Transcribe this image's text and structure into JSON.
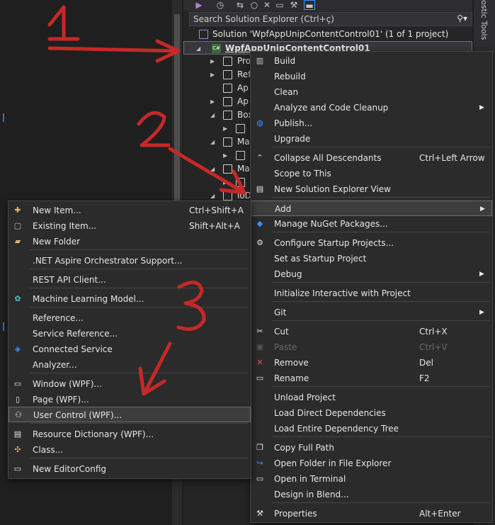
{
  "solution_explorer": {
    "search_placeholder": "Search Solution Explorer (Ctrl+ç)",
    "solution_label": "Solution 'WpfAppUnipContentControl01' (1 of 1 project)",
    "project_label": "WpfAppUnipContentControl01",
    "tree": [
      {
        "label": "Pro"
      },
      {
        "label": "Ref"
      },
      {
        "label": "Ap"
      },
      {
        "label": "Ap"
      },
      {
        "label": "Box"
      },
      {
        "label": ""
      },
      {
        "label": "Ma"
      },
      {
        "label": ""
      },
      {
        "label": "Ma"
      },
      {
        "label": ""
      },
      {
        "label": "ioD"
      }
    ]
  },
  "side_tab": {
    "label": "ostic Tools"
  },
  "context_menu": {
    "items": [
      {
        "label": "Build",
        "icon": "build-icon"
      },
      {
        "label": "Rebuild"
      },
      {
        "label": "Clean"
      },
      {
        "label": "Analyze and Code Cleanup",
        "submenu": true
      },
      {
        "label": "Publish...",
        "icon": "globe-icon"
      },
      {
        "label": "Upgrade"
      },
      {
        "label": "Collapse All Descendants",
        "shortcut": "Ctrl+Left Arrow",
        "icon": "collapse-icon"
      },
      {
        "label": "Scope to This"
      },
      {
        "label": "New Solution Explorer View",
        "icon": "new-view-icon"
      },
      {
        "label": "Add",
        "submenu": true
      },
      {
        "label": "Manage NuGet Packages...",
        "icon": "nuget-icon"
      },
      {
        "label": "Configure Startup Projects...",
        "icon": "gear-icon"
      },
      {
        "label": "Set as Startup Project"
      },
      {
        "label": "Debug",
        "submenu": true
      },
      {
        "label": "Initialize Interactive with Project"
      },
      {
        "label": "Git",
        "submenu": true
      },
      {
        "label": "Cut",
        "shortcut": "Ctrl+X",
        "icon": "scissors-icon"
      },
      {
        "label": "Paste",
        "shortcut": "Ctrl+V",
        "icon": "paste-icon",
        "disabled": true
      },
      {
        "label": "Remove",
        "shortcut": "Del",
        "icon": "remove-icon"
      },
      {
        "label": "Rename",
        "shortcut": "F2",
        "icon": "rename-icon"
      },
      {
        "label": "Unload Project"
      },
      {
        "label": "Load Direct Dependencies"
      },
      {
        "label": "Load Entire Dependency Tree"
      },
      {
        "label": "Copy Full Path",
        "icon": "copy-icon"
      },
      {
        "label": "Open Folder in File Explorer",
        "icon": "open-folder-icon"
      },
      {
        "label": "Open in Terminal",
        "icon": "terminal-icon"
      },
      {
        "label": "Design in Blend..."
      },
      {
        "label": "Properties",
        "shortcut": "Alt+Enter",
        "icon": "wrench-icon"
      }
    ]
  },
  "add_submenu": {
    "items": [
      {
        "label": "New Item...",
        "shortcut": "Ctrl+Shift+A",
        "icon": "new-item-icon"
      },
      {
        "label": "Existing Item...",
        "shortcut": "Shift+Alt+A",
        "icon": "existing-item-icon"
      },
      {
        "label": "New Folder",
        "icon": "folder-icon"
      },
      {
        "label": ".NET Aspire Orchestrator Support..."
      },
      {
        "label": "REST API Client..."
      },
      {
        "label": "Machine Learning Model...",
        "icon": "ml-model-icon"
      },
      {
        "label": "Reference..."
      },
      {
        "label": "Service Reference..."
      },
      {
        "label": "Connected Service",
        "icon": "connected-service-icon"
      },
      {
        "label": "Analyzer..."
      },
      {
        "label": "Window (WPF)...",
        "icon": "window-icon"
      },
      {
        "label": "Page (WPF)...",
        "icon": "page-icon"
      },
      {
        "label": "User Control (WPF)...",
        "icon": "user-control-icon"
      },
      {
        "label": "Resource Dictionary (WPF)...",
        "icon": "resource-dictionary-icon"
      },
      {
        "label": "Class...",
        "icon": "class-icon"
      },
      {
        "label": "New EditorConfig",
        "icon": "editorconfig-icon"
      }
    ]
  },
  "annotations": {
    "step1": "1",
    "step2": "2",
    "step3": "3"
  },
  "colors": {
    "annotation": "#c62828",
    "menu_bg": "#2b2b2b",
    "accent": "#3794ff"
  }
}
